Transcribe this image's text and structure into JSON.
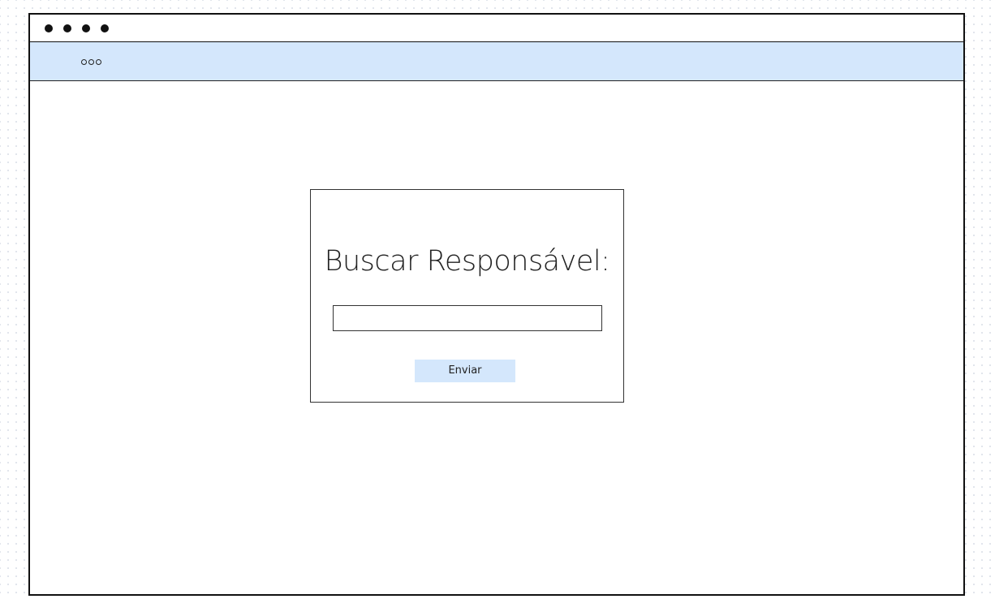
{
  "window": {
    "controls": [
      "window-dot",
      "window-dot",
      "window-dot",
      "window-dot"
    ]
  },
  "navbar": {
    "menu_icon": "three-rings-menu-icon"
  },
  "search_form": {
    "title": "Buscar Responsável:",
    "input_value": "",
    "input_placeholder": "",
    "submit_label": "Enviar"
  },
  "colors": {
    "accent": "#d4e7fc",
    "border": "#111111",
    "text": "#222222"
  }
}
